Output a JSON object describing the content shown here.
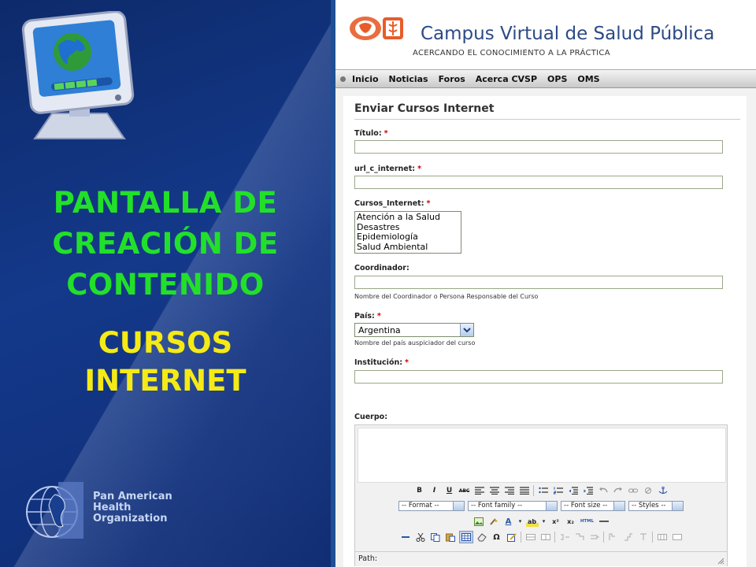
{
  "slide": {
    "title_lines": [
      "PANTALLA DE",
      "CREACIÓN DE",
      "CONTENIDO"
    ],
    "subtitle_lines": [
      "CURSOS",
      "INTERNET"
    ],
    "organization_lines": [
      "Pan American",
      "Health",
      "Organization"
    ],
    "colors": {
      "title": "#22e02a",
      "subtitle": "#f5ea16",
      "background": "#14398a"
    }
  },
  "site": {
    "title": "Campus Virtual de Salud Pública",
    "tagline": "ACERCANDO EL CONOCIMIENTO A LA PRÁCTICA"
  },
  "nav": {
    "items": [
      "Inicio",
      "Noticias",
      "Foros",
      "Acerca CVSP",
      "OPS",
      "OMS"
    ]
  },
  "form": {
    "heading": "Enviar Cursos Internet",
    "required_mark": "*",
    "fields": {
      "titulo": {
        "label": "Título:",
        "value": ""
      },
      "url": {
        "label": "url_c_internet:",
        "value": ""
      },
      "cursos": {
        "label": "Cursos_Internet:",
        "options": [
          "Atención a la Salud",
          "Desastres",
          "Epidemiología",
          "Salud Ambiental"
        ]
      },
      "coordinador": {
        "label": "Coordinador:",
        "value": "",
        "help": "Nombre del Coordinador o Persona Responsable del Curso"
      },
      "pais": {
        "label": "País:",
        "value": "Argentina",
        "help": "Nombre del país auspiciador del curso"
      },
      "institucion": {
        "label": "Institución:",
        "value": ""
      },
      "cuerpo": {
        "label": "Cuerpo:"
      }
    },
    "editor": {
      "format": "-- Format --",
      "font_family": "-- Font family --",
      "font_size": "-- Font size --",
      "styles": "-- Styles --",
      "bold": "B",
      "italic": "I",
      "underline": "U",
      "strike": "ABC",
      "html": "HTML",
      "path_label": "Path:"
    }
  }
}
